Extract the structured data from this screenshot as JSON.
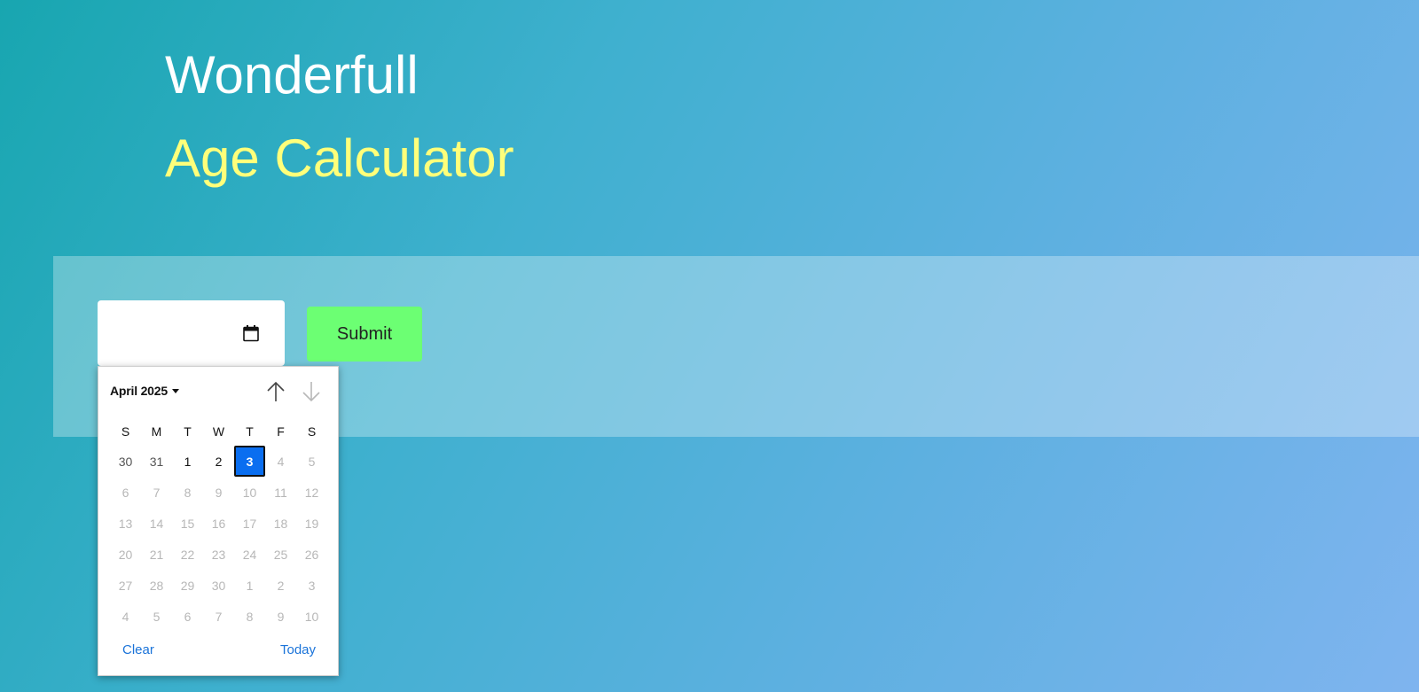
{
  "header": {
    "title_line1": "Wonderfull",
    "title_line2": "Age Calculator"
  },
  "form": {
    "date_value": "",
    "submit_label": "Submit"
  },
  "datepicker": {
    "month_label": "April 2025",
    "weekdays": [
      "S",
      "M",
      "T",
      "W",
      "T",
      "F",
      "S"
    ],
    "weeks": [
      [
        {
          "d": "30",
          "s": "prev"
        },
        {
          "d": "31",
          "s": "prev"
        },
        {
          "d": "1",
          "s": "cur"
        },
        {
          "d": "2",
          "s": "cur"
        },
        {
          "d": "3",
          "s": "sel"
        },
        {
          "d": "4",
          "s": "muted"
        },
        {
          "d": "5",
          "s": "muted"
        }
      ],
      [
        {
          "d": "6",
          "s": "muted"
        },
        {
          "d": "7",
          "s": "muted"
        },
        {
          "d": "8",
          "s": "muted"
        },
        {
          "d": "9",
          "s": "muted"
        },
        {
          "d": "10",
          "s": "muted"
        },
        {
          "d": "11",
          "s": "muted"
        },
        {
          "d": "12",
          "s": "muted"
        }
      ],
      [
        {
          "d": "13",
          "s": "muted"
        },
        {
          "d": "14",
          "s": "muted"
        },
        {
          "d": "15",
          "s": "muted"
        },
        {
          "d": "16",
          "s": "muted"
        },
        {
          "d": "17",
          "s": "muted"
        },
        {
          "d": "18",
          "s": "muted"
        },
        {
          "d": "19",
          "s": "muted"
        }
      ],
      [
        {
          "d": "20",
          "s": "muted"
        },
        {
          "d": "21",
          "s": "muted"
        },
        {
          "d": "22",
          "s": "muted"
        },
        {
          "d": "23",
          "s": "muted"
        },
        {
          "d": "24",
          "s": "muted"
        },
        {
          "d": "25",
          "s": "muted"
        },
        {
          "d": "26",
          "s": "muted"
        }
      ],
      [
        {
          "d": "27",
          "s": "muted"
        },
        {
          "d": "28",
          "s": "muted"
        },
        {
          "d": "29",
          "s": "muted"
        },
        {
          "d": "30",
          "s": "muted"
        },
        {
          "d": "1",
          "s": "muted"
        },
        {
          "d": "2",
          "s": "muted"
        },
        {
          "d": "3",
          "s": "muted"
        }
      ],
      [
        {
          "d": "4",
          "s": "muted"
        },
        {
          "d": "5",
          "s": "muted"
        },
        {
          "d": "6",
          "s": "muted"
        },
        {
          "d": "7",
          "s": "muted"
        },
        {
          "d": "8",
          "s": "muted"
        },
        {
          "d": "9",
          "s": "muted"
        },
        {
          "d": "10",
          "s": "muted"
        }
      ]
    ],
    "clear_label": "Clear",
    "today_label": "Today",
    "icons": {
      "calendar": "calendar-icon",
      "prev_month": "arrow-up-icon",
      "next_month": "arrow-down-icon",
      "month_dropdown": "caret-down-icon"
    }
  },
  "colors": {
    "title_primary": "#ffffff",
    "title_accent": "#ffff7a",
    "submit_bg": "#6cff73",
    "selected_day_bg": "#0a6ef0",
    "link": "#1a73d9"
  }
}
